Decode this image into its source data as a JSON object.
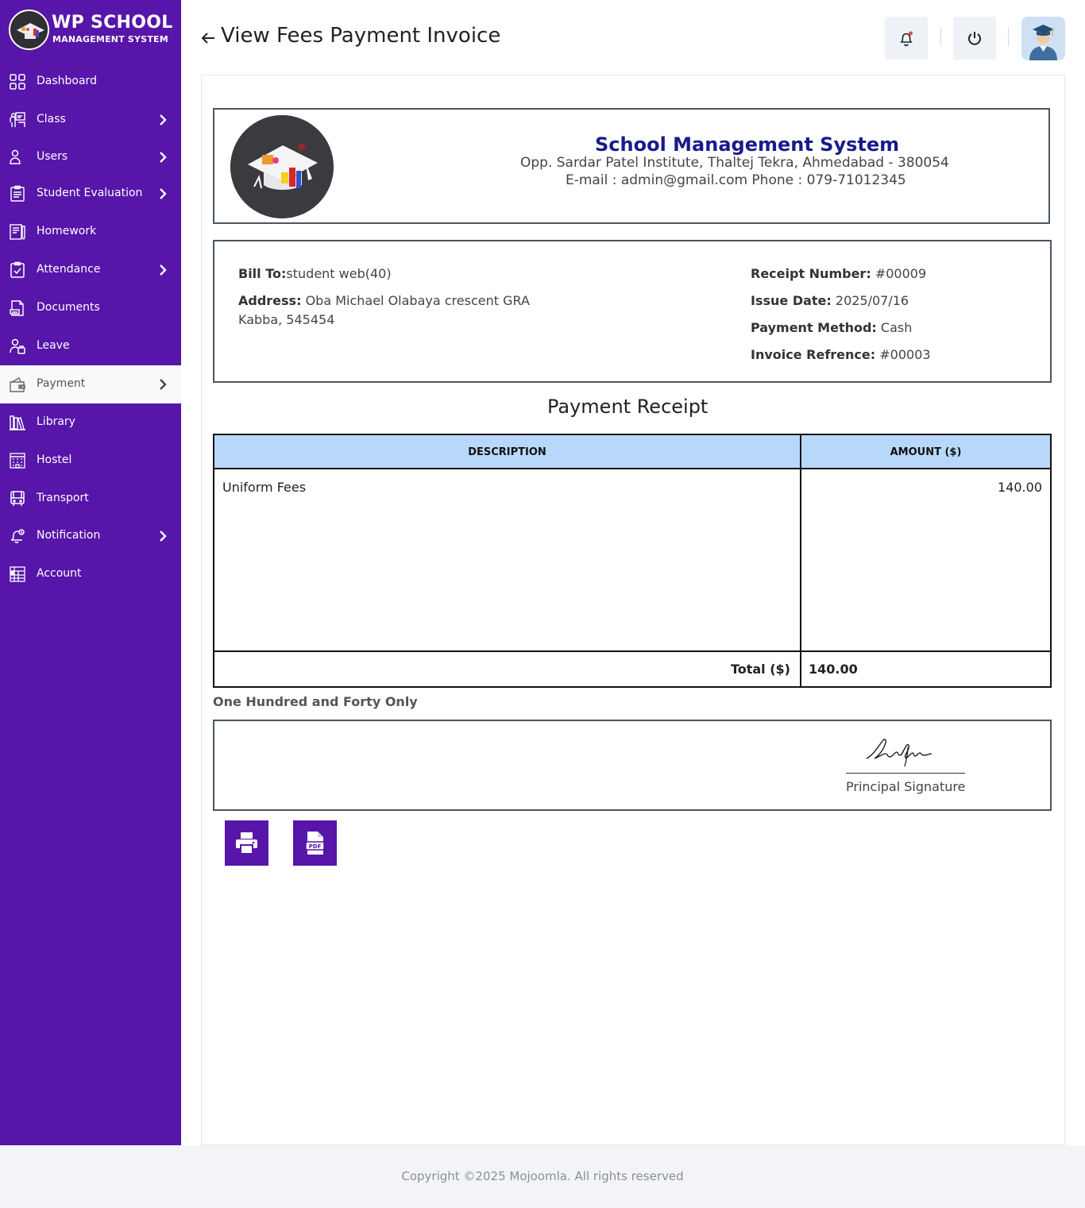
{
  "brand": {
    "title": "WP SCHOOL",
    "subtitle": "MANAGEMENT SYSTEM"
  },
  "sidebar": {
    "items": [
      {
        "label": "Dashboard",
        "icon": "dashboard-icon",
        "has_submenu": false
      },
      {
        "label": "Class",
        "icon": "class-icon",
        "has_submenu": true
      },
      {
        "label": "Users",
        "icon": "user-icon",
        "has_submenu": true
      },
      {
        "label": "Student Evaluation",
        "icon": "evaluation-icon",
        "has_submenu": true
      },
      {
        "label": "Homework",
        "icon": "homework-icon",
        "has_submenu": false
      },
      {
        "label": "Attendance",
        "icon": "attendance-icon",
        "has_submenu": true
      },
      {
        "label": "Documents",
        "icon": "document-icon",
        "has_submenu": false
      },
      {
        "label": "Leave",
        "icon": "leave-icon",
        "has_submenu": false
      },
      {
        "label": "Payment",
        "icon": "wallet-icon",
        "has_submenu": true,
        "active": true
      },
      {
        "label": "Library",
        "icon": "library-icon",
        "has_submenu": false
      },
      {
        "label": "Hostel",
        "icon": "hostel-icon",
        "has_submenu": false
      },
      {
        "label": "Transport",
        "icon": "bus-icon",
        "has_submenu": false
      },
      {
        "label": "Notification",
        "icon": "bell-icon",
        "has_submenu": true
      },
      {
        "label": "Account",
        "icon": "account-icon",
        "has_submenu": false
      }
    ]
  },
  "header": {
    "title": "View Fees Payment Invoice"
  },
  "school": {
    "name": "School Management System",
    "address": "Opp. Sardar Patel Institute, Thaltej Tekra, Ahmedabad - 380054",
    "contact": "E-mail : admin@gmail.com  Phone : 079-71012345"
  },
  "bill": {
    "bill_to_label": "Bill To:",
    "bill_to_value": "student web(40)",
    "address_label": "Address:",
    "address_line1": "Oba Michael Olabaya crescent GRA",
    "address_line2": "Kabba, 545454",
    "receipt_number_label": "Receipt Number:",
    "receipt_number_value": "#00009",
    "issue_date_label": "Issue Date:",
    "issue_date_value": "2025/07/16",
    "payment_method_label": "Payment Method:",
    "payment_method_value": "Cash",
    "invoice_ref_label": "Invoice Refrence:",
    "invoice_ref_value": "#00003"
  },
  "receipt": {
    "title": "Payment Receipt",
    "columns": [
      "DESCRIPTION",
      "AMOUNT ($)"
    ],
    "rows": [
      {
        "description": "Uniform Fees",
        "amount": "140.00"
      }
    ],
    "total_label": "Total ($)",
    "total_value": "140.00",
    "amount_in_words": "One Hundred and Forty Only"
  },
  "signature": {
    "label": "Principal Signature"
  },
  "actions": {
    "print": "print-icon",
    "pdf": "pdf-icon"
  },
  "footer": {
    "text": "Copyright ©2025 Mojoomla. All rights reserved"
  },
  "colors": {
    "sidebar": "#5715a9",
    "table_header": "#b8d8fb",
    "school_name": "#1a1a8c"
  }
}
